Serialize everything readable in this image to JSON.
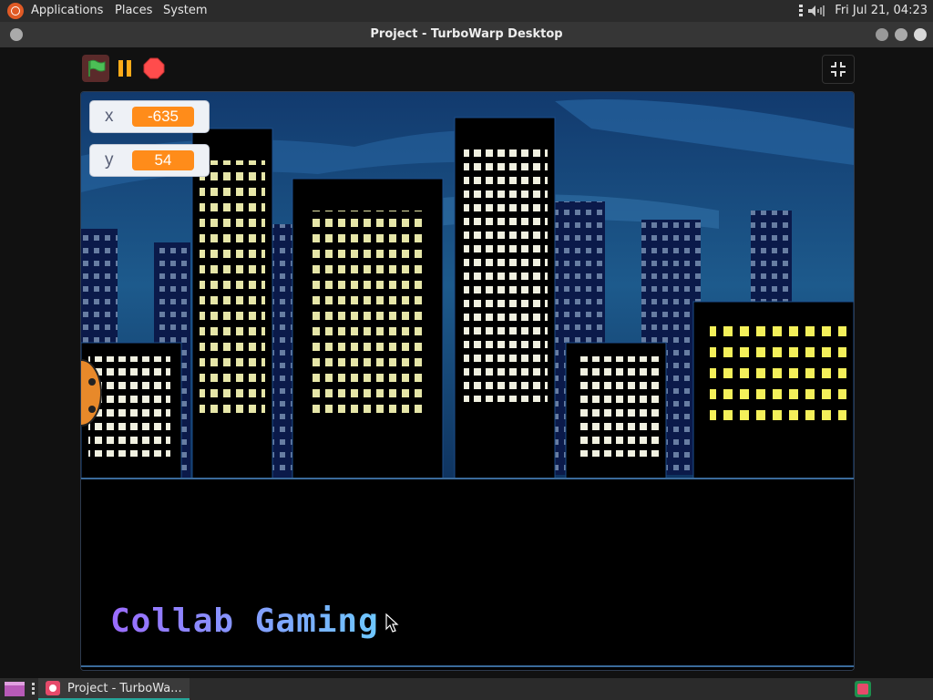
{
  "top_panel": {
    "menu": [
      "Applications",
      "Places",
      "System"
    ],
    "clock": "Fri Jul 21, 04:23"
  },
  "window": {
    "title": "Project - TurboWarp Desktop"
  },
  "stage": {
    "monitors": [
      {
        "label": "x",
        "value": "-635"
      },
      {
        "label": "y",
        "value": "54"
      }
    ],
    "text": "Collab Gaming"
  },
  "taskbar": {
    "task_label": "Project - TurboWa..."
  },
  "colors": {
    "flag": "#4cbf56",
    "pause": "#ffab19",
    "stop": "#ff4c4c",
    "monitor_value": "#ff8c1a"
  }
}
